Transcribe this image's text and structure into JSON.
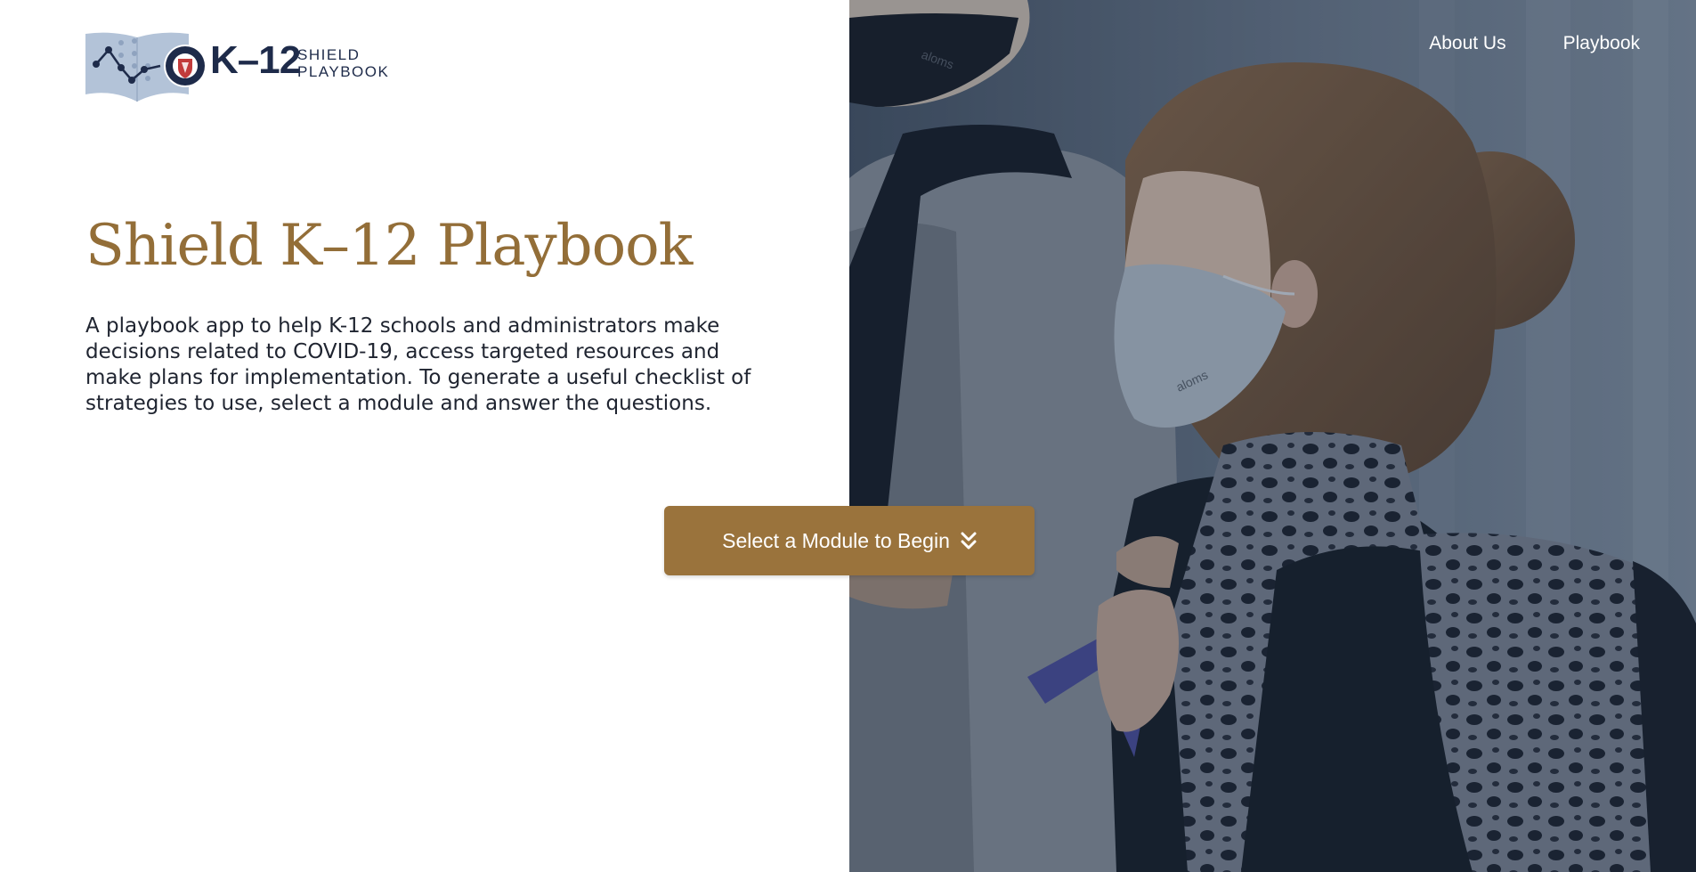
{
  "logo": {
    "mark": "K–12",
    "sub_line1": "SHIELD",
    "sub_line2": "PLAYBOOK",
    "icon": "open-book-chart-shield-icon"
  },
  "nav": {
    "items": [
      {
        "label": "About Us"
      },
      {
        "label": "Playbook"
      }
    ]
  },
  "hero": {
    "title": "Shield K–12 Playbook",
    "description": "A playbook app to help K-12 schools and administrators make decisions related to COVID-19, access targeted resources and make plans for implementation. To generate a useful checklist of strategies to use, select a module and answer the questions.",
    "cta_label": "Select a Module to Begin",
    "cta_icon": "double-chevron-down-icon",
    "photo": "two children wearing face masks and backpacks in a school hallway"
  },
  "colors": {
    "accent": "#9a733c",
    "title": "#936e38",
    "navy": "#1e2b4a",
    "text": "#1f2430",
    "nav_text": "#ffffff"
  }
}
